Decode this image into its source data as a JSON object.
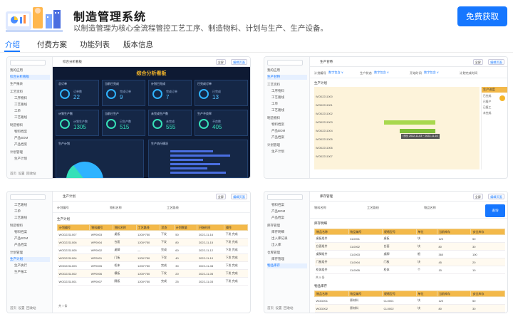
{
  "header": {
    "title": "制造管理系统",
    "description": "以制造管理为核心全流程管控工艺工序、制造物料、计划与生产、生产设备。",
    "cta_label": "免费获取"
  },
  "tabs": [
    {
      "label": "介绍",
      "active": true
    },
    {
      "label": "付费方案",
      "active": false
    },
    {
      "label": "功能列表",
      "active": false
    },
    {
      "label": "版本信息",
      "active": false
    }
  ],
  "colors": {
    "accent": "#1677ff",
    "dashboard_bg": "#0e1a33",
    "table_header": "#f3b94a"
  },
  "screens": {
    "dashboard": {
      "breadcrumb": "综合分析看板",
      "title": "综合分析看板",
      "btn_fullscreen": "全屏",
      "btn_edit": "编辑页面",
      "sidebar": [
        "我的应用",
        "综合分析看板",
        "生产报表",
        "工艺资料",
        "工序物料",
        "工艺路线",
        "工单",
        "工艺路线",
        "制造物料",
        "物料档案",
        "产品BOM",
        "产品档案",
        "计划管理",
        "生产计划"
      ],
      "footer": [
        "首页",
        "设置",
        "回收站"
      ],
      "cards": [
        {
          "label": "总订单",
          "key": "订单数",
          "value": "22"
        },
        {
          "label": "当前已完成",
          "key": "完成订单",
          "value": "9"
        },
        {
          "label": "计划已完成",
          "key": "完成订单",
          "value": "7"
        },
        {
          "label": "已完成订单",
          "key": "已完成",
          "value": "13"
        },
        {
          "label": "计划生产数",
          "key": "计划生产数",
          "value": "1305"
        },
        {
          "label": "当前已生产",
          "key": "已生产数",
          "value": "515"
        },
        {
          "label": "未完成生产数",
          "key": "未完成",
          "value": "555"
        },
        {
          "label": "生产不良率",
          "key": "不良数",
          "value": "405"
        }
      ],
      "lower_labels": [
        "生产计划",
        "生产执行情况"
      ]
    },
    "gantt": {
      "breadcrumb": "生产甘特",
      "btn_fullscreen": "全屏",
      "btn_edit": "编辑页面",
      "filters": [
        "计划编号",
        "生产状态",
        "开始时间",
        "计划完成时间"
      ],
      "filter_value": "数字包含 ∨",
      "section": "生产计划",
      "rows": [
        "WOD2211000",
        "WOD2211001",
        "WOD2211002",
        "WOD2211003",
        "WOD2211004",
        "WOD2211005",
        "WOD2211006",
        "WOD2211007"
      ],
      "tooltip": "计划: 2022-11-03 ~ 2022-11-16",
      "panel_header": "生产进度",
      "panel_rows": [
        "已完成",
        "已报产",
        "已报工",
        "未完成"
      ],
      "sidebar": [
        "我的应用",
        "生产甘特",
        "工艺资料",
        "工序物料",
        "工艺路线",
        "工单",
        "工艺路线",
        "制造物料",
        "物料档案",
        "产品BOM",
        "产品档案",
        "计划管理",
        "生产计划"
      ]
    },
    "plan_list": {
      "breadcrumb": "生产计划",
      "btn_fullscreen": "全屏",
      "btn_edit": "编辑页面",
      "filters": [
        "计划编号",
        "物料名称",
        "工艺路线"
      ],
      "section": "生产计划",
      "columns": [
        "计划编号",
        "物料编号",
        "物料名称",
        "工艺路线",
        "状态",
        "计划数量",
        "开始时间",
        "操作"
      ],
      "rows": [
        [
          "WOD2211007",
          "WP0003",
          "桌板",
          "1200*750",
          "下发",
          "50",
          "2022-11-16",
          "下发 完成"
        ],
        [
          "WOD2211006",
          "WP0004",
          "台面",
          "1200*750",
          "下发",
          "80",
          "2022-11-15",
          "下发 完成"
        ],
        [
          "WOD2211005",
          "WP0002",
          "桌脚",
          "—",
          "完成",
          "60",
          "2022-11-12",
          "下发 完成"
        ],
        [
          "WOD2211004",
          "WP0001",
          "门板",
          "1200*750",
          "下发",
          "40",
          "2022-11-10",
          "下发 完成"
        ],
        [
          "WOD2211003",
          "WP0005",
          "柜体",
          "1200*750",
          "完成",
          "30",
          "2022-11-08",
          "下发 完成"
        ],
        [
          "WOD2211002",
          "WP0006",
          "横板",
          "1200*750",
          "下发",
          "20",
          "2022-11-05",
          "下发 完成"
        ],
        [
          "WOD2211001",
          "WP0007",
          "隔板",
          "1200*750",
          "完成",
          "25",
          "2022-11-03",
          "下发 完成"
        ]
      ],
      "pager": "共 7 条",
      "sidebar": [
        "工艺路线",
        "工单",
        "工艺路线",
        "制造物料",
        "物料档案",
        "产品BOM",
        "产品档案",
        "计划管理",
        "生产计划",
        "生产执行",
        "生产报工"
      ],
      "footer": [
        "首页",
        "设置",
        "回收站"
      ]
    },
    "material": {
      "breadcrumb": "库存管理",
      "btn_fullscreen": "全屏",
      "btn_edit": "编辑页面",
      "primary_button": "查询",
      "filters": [
        "物料名称",
        "工艺路线",
        "物品名称"
      ],
      "section_top": "库存明细",
      "section_bottom": "物品库存",
      "columns": [
        "物品名称",
        "物品编号",
        "规格型号",
        "单位",
        "当前库存",
        "安全库存"
      ],
      "rows": [
        [
          "桌板组件",
          "CL0001",
          "桌板",
          "块",
          "120",
          "50"
        ],
        [
          "台面组件",
          "CL0002",
          "台面",
          "块",
          "80",
          "30"
        ],
        [
          "桌脚组件",
          "CL0003",
          "桌脚",
          "根",
          "360",
          "100"
        ],
        [
          "门板组件",
          "CL0004",
          "门板",
          "块",
          "45",
          "20"
        ],
        [
          "柜体组件",
          "CL0005",
          "柜体",
          "个",
          "15",
          "10"
        ]
      ],
      "bottom_rows": [
        [
          "WOD001",
          "原材料",
          "CL0001",
          "块",
          "120",
          "50"
        ],
        [
          "WOD002",
          "原材料",
          "CL0002",
          "块",
          "80",
          "30"
        ]
      ],
      "pager": "共 5 条",
      "sidebar": [
        "物料档案",
        "产品BOM",
        "产品档案",
        "库存管理",
        "库存明细",
        "出入库记录",
        "出入库",
        "仓库管理",
        "库存管理",
        "物品库存"
      ],
      "footer": [
        "首页",
        "设置",
        "回收站"
      ]
    }
  }
}
